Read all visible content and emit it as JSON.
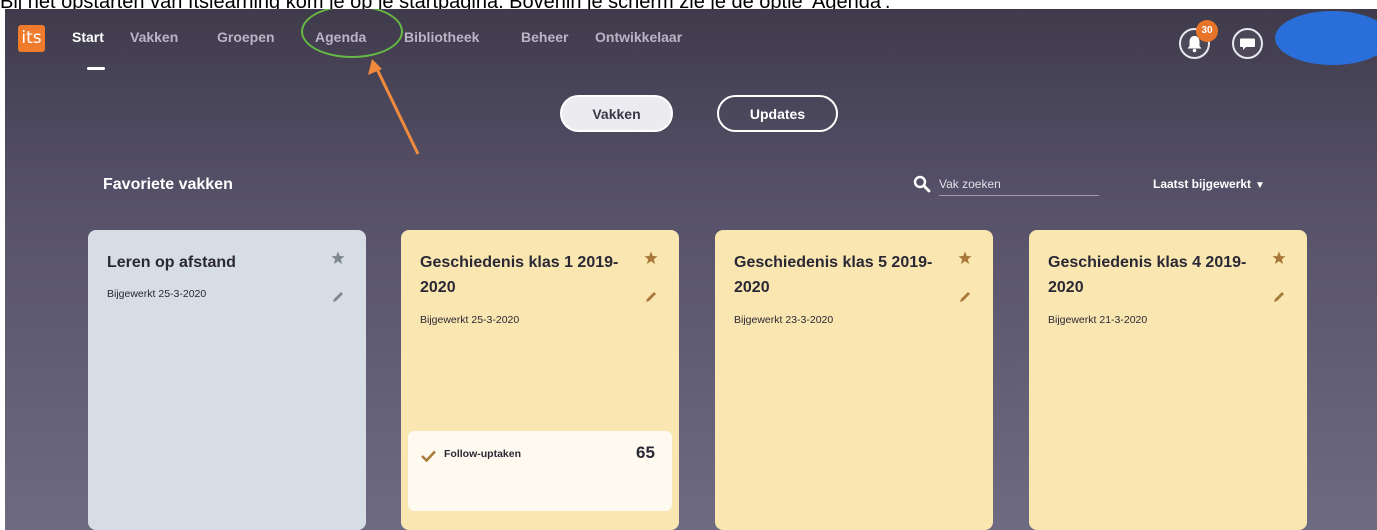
{
  "caption": "Bij het opstarten van Itslearning kom je op je startpagina. Bovenin je scherm zie je de optie 'Agenda'.",
  "logo": "its",
  "nav": {
    "items": [
      {
        "label": "Start"
      },
      {
        "label": "Vakken"
      },
      {
        "label": "Groepen"
      },
      {
        "label": "Agenda"
      },
      {
        "label": "Bibliotheek"
      },
      {
        "label": "Beheer"
      },
      {
        "label": "Ontwikkelaar"
      }
    ],
    "active": "Start"
  },
  "header_icons": {
    "notifications_icon": "bell-icon",
    "notifications_count": "30",
    "messages_icon": "chat-bubble-icon",
    "avatar_color": "#2a6fd9"
  },
  "tabs": [
    {
      "label": "Vakken",
      "selected": true
    },
    {
      "label": "Updates",
      "selected": false
    }
  ],
  "favorites": {
    "title": "Favoriete vakken",
    "search_placeholder": "Vak zoeken",
    "sort_label": "Laatst bijgewerkt"
  },
  "cards": [
    {
      "title": "Leren op afstand",
      "updated": "Bijgewerkt 25-3-2020",
      "color": "#d6dde4",
      "starred": false
    },
    {
      "title": "Geschiedenis klas 1 2019-2020",
      "updated": "Bijgewerkt 25-3-2020",
      "color": "#f9e6b0",
      "starred": true,
      "followup": {
        "label": "Follow-uptaken",
        "count": "65"
      }
    },
    {
      "title": "Geschiedenis klas 5 2019-2020",
      "updated": "Bijgewerkt 23-3-2020",
      "color": "#f9e6b0",
      "starred": true
    },
    {
      "title": "Geschiedenis klas 4 2019-2020",
      "updated": "Bijgewerkt 21-3-2020",
      "color": "#f9e6b0",
      "starred": true
    }
  ],
  "colors": {
    "accent_orange": "#f07b2d",
    "annotation_green": "#66b845",
    "annotation_arrow": "#f08a3c"
  }
}
